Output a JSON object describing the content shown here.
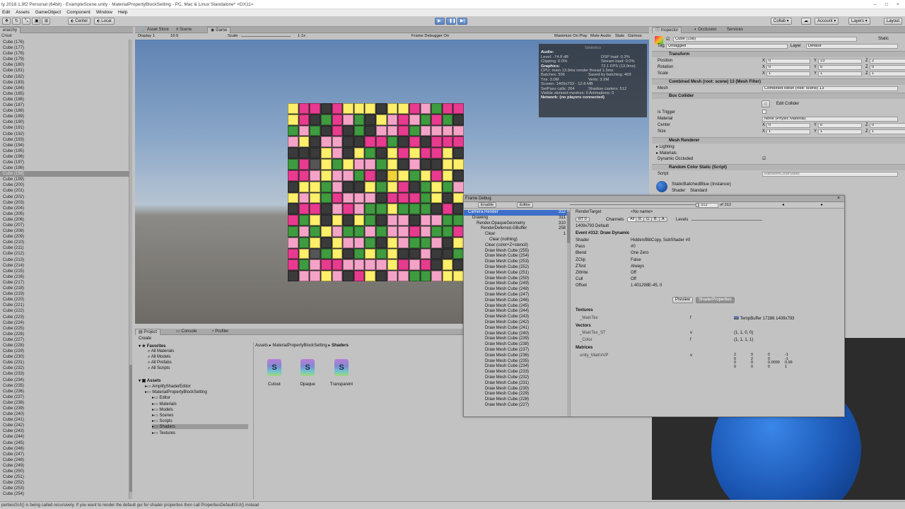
{
  "window": {
    "title": "ty 2018.1.9f2 Personal (64bit) - ExampleScene.unity - MaterialPropertyBlockSetting - PC, Mac & Linux Standalone* <DX11>"
  },
  "menu": [
    "Edit",
    "Assets",
    "GameObject",
    "Component",
    "Window",
    "Help"
  ],
  "toolbar": {
    "pivot": "Center",
    "space": "Local",
    "collab": "Collab",
    "account": "Account",
    "layers": "Layers",
    "layout": "Layout"
  },
  "hierarchy": {
    "tab": "erarchy",
    "create": "Creat",
    "selected_index": 23,
    "items": [
      "Cube (176)",
      "Cube (177)",
      "Cube (178)",
      "Cube (179)",
      "Cube (180)",
      "Cube (181)",
      "Cube (182)",
      "Cube (183)",
      "Cube (184)",
      "Cube (185)",
      "Cube (186)",
      "Cube (187)",
      "Cube (188)",
      "Cube (189)",
      "Cube (190)",
      "Cube (191)",
      "Cube (192)",
      "Cube (193)",
      "Cube (194)",
      "Cube (195)",
      "Cube (196)",
      "Cube (197)",
      "Cube (198)",
      "Cube (198)",
      "Cube (199)",
      "Cube (200)",
      "Cube (201)",
      "Cube (202)",
      "Cube (203)",
      "Cube (204)",
      "Cube (205)",
      "Cube (206)",
      "Cube (207)",
      "Cube (208)",
      "Cube (209)",
      "Cube (210)",
      "Cube (211)",
      "Cube (212)",
      "Cube (213)",
      "Cube (214)",
      "Cube (215)",
      "Cube (216)",
      "Cube (217)",
      "Cube (218)",
      "Cube (219)",
      "Cube (220)",
      "Cube (221)",
      "Cube (222)",
      "Cube (223)",
      "Cube (224)",
      "Cube (225)",
      "Cube (226)",
      "Cube (227)",
      "Cube (228)",
      "Cube (229)",
      "Cube (230)",
      "Cube (231)",
      "Cube (232)",
      "Cube (233)",
      "Cube (234)",
      "Cube (235)",
      "Cube (236)",
      "Cube (237)",
      "Cube (238)",
      "Cube (239)",
      "Cube (240)",
      "Cube (241)",
      "Cube (242)",
      "Cube (243)",
      "Cube (244)",
      "Cube (245)",
      "Cube (246)",
      "Cube (247)",
      "Cube (248)",
      "Cube (249)",
      "Cube (250)",
      "Cube (251)",
      "Cube (252)",
      "Cube (253)",
      "Cube (254)"
    ]
  },
  "center_tabs": {
    "asset_store": "Asset Store",
    "scene": "Scene",
    "game": "Game"
  },
  "game_bar": {
    "display": "Display 1",
    "aspect": "16:9",
    "scale_label": "Scale",
    "scale_value": "1.1x",
    "frame_debugger": "Frame Debugger On",
    "maximize": "Maximize On Play",
    "mute": "Mute Audio",
    "stats": "Stats",
    "gizmos": "Gizmos"
  },
  "cube_colors": [
    "#e83b8f",
    "#f2d33a",
    "#3bd1e8",
    "#7a4bd6",
    "#3f9b3f",
    "#f09a2d",
    "#2d6fd6",
    "#d9d9d9",
    "#f4a3c7",
    "#8fd14f",
    "#e84a4a",
    "#4ac7a0",
    "#3a3a3a",
    "#555555",
    "#6ac2ff",
    "#c04ad6",
    "#ffef6a",
    "#a07040",
    "#2e2e2e",
    "#47b8f0"
  ],
  "stats": {
    "title": "Statistics",
    "audio_label": "Audio:",
    "level": "Level: -74.8 dB",
    "dsp": "DSP load: 0.2%",
    "clipping": "Clipping: 0.0%",
    "stream": "Stream load: 0.0%",
    "graphics_label": "Graphics:",
    "fps": "72.1 FPS (13.9ms)",
    "cpu": "CPU: main 13.9ms  render thread 1.5ms",
    "batches": "Batches: 306",
    "saved": "Saved by batching: 469",
    "tris": "Tris: 3.0M",
    "verts": "Verts: 3.9M",
    "screen": "Screen: 1409x793 - 12.8 MB",
    "setpass": "SetPass calls: 264",
    "shadow": "Shadow casters: 512",
    "visible": "Visible skinned meshes: 0  Animations: 0",
    "network": "Network: (no players connected)"
  },
  "inspector": {
    "tabs": [
      "Inspector",
      "Occlusion",
      "Services"
    ],
    "name": "Cube (198)",
    "tag_label": "Tag",
    "tag": "Untagged",
    "layer_label": "Layer",
    "layer": "Default",
    "static": "Static",
    "transform": "Transform",
    "position": "Position",
    "rotation": "Rotation",
    "scale": "Scale",
    "pos": [
      "0",
      "13",
      "2"
    ],
    "rot": [
      "0",
      "0",
      "0"
    ],
    "scl": [
      "1",
      "1",
      "1"
    ],
    "mesh_filter": "Combined Mesh (root: scene) 13 (Mesh Filter)",
    "mesh_label": "Mesh",
    "mesh_value": "Combined Mesh (root: scene) 13",
    "box_collider": "Box Collider",
    "edit_collider": "Edit Collider",
    "is_trigger": "Is Trigger",
    "material_label": "Material",
    "material_value": "None (Physic Material)",
    "center_label": "Center",
    "size_label": "Size",
    "center": [
      "0",
      "0",
      "0"
    ],
    "size": [
      "1",
      "1",
      "1"
    ],
    "mesh_renderer": "Mesh Renderer",
    "lighting": "Lighting",
    "materials": "Materials",
    "dynamic_occluded": "Dynamic Occluded",
    "random_color": "Random Color Static (Script)",
    "script_label": "Script",
    "script_value": "RandomColorStatic",
    "material_instance": "StaticBatchedBlue (Instance)",
    "shader_label": "Shader",
    "shader_value": "Standard"
  },
  "project": {
    "tabs": [
      "Project",
      "Console",
      "Profiler"
    ],
    "create": "Create",
    "favorites": "Favorites",
    "fav_items": [
      "All Materials",
      "All Models",
      "All Prefabs",
      "All Scripts"
    ],
    "assets": "Assets",
    "asset_items": [
      "AmplifyShaderEditor",
      "MaterialPropertyBlockSetting",
      "Editor",
      "Materials",
      "Models",
      "Scenes",
      "Scripts",
      "Shaders",
      "Textures"
    ],
    "breadcrumb": [
      "Assets",
      "MaterialPropertyBlockSetting",
      "Shaders"
    ],
    "files": [
      "Cutout",
      "Opaque",
      "Transparent"
    ]
  },
  "frame_debug": {
    "title": "Frame Debug",
    "enable": "Enable",
    "editor": "Editor",
    "event_index": "312",
    "event_total": "of 312",
    "rows": [
      {
        "t": "Camera.Render",
        "n": "312",
        "d": 0
      },
      {
        "t": "Drawing",
        "n": "311",
        "d": 1
      },
      {
        "t": "Render.OpaqueGeometry",
        "n": "310",
        "d": 2
      },
      {
        "t": "RenderDeferred.GBuffer",
        "n": "258",
        "d": 3
      },
      {
        "t": "Clear",
        "n": "1",
        "d": 4
      },
      {
        "t": "Clear (nothing)",
        "n": "",
        "d": 5
      },
      {
        "t": "Clear (color+Z+stencil)",
        "n": "",
        "d": 4
      },
      {
        "t": "Draw Mesh Cube (255)",
        "n": "",
        "d": 4
      },
      {
        "t": "Draw Mesh Cube (254)",
        "n": "",
        "d": 4
      },
      {
        "t": "Draw Mesh Cube (253)",
        "n": "",
        "d": 4
      },
      {
        "t": "Draw Mesh Cube (252)",
        "n": "",
        "d": 4
      },
      {
        "t": "Draw Mesh Cube (251)",
        "n": "",
        "d": 4
      },
      {
        "t": "Draw Mesh Cube (250)",
        "n": "",
        "d": 4
      },
      {
        "t": "Draw Mesh Cube (249)",
        "n": "",
        "d": 4
      },
      {
        "t": "Draw Mesh Cube (248)",
        "n": "",
        "d": 4
      },
      {
        "t": "Draw Mesh Cube (247)",
        "n": "",
        "d": 4
      },
      {
        "t": "Draw Mesh Cube (246)",
        "n": "",
        "d": 4
      },
      {
        "t": "Draw Mesh Cube (245)",
        "n": "",
        "d": 4
      },
      {
        "t": "Draw Mesh Cube (244)",
        "n": "",
        "d": 4
      },
      {
        "t": "Draw Mesh Cube (243)",
        "n": "",
        "d": 4
      },
      {
        "t": "Draw Mesh Cube (242)",
        "n": "",
        "d": 4
      },
      {
        "t": "Draw Mesh Cube (241)",
        "n": "",
        "d": 4
      },
      {
        "t": "Draw Mesh Cube (240)",
        "n": "",
        "d": 4
      },
      {
        "t": "Draw Mesh Cube (239)",
        "n": "",
        "d": 4
      },
      {
        "t": "Draw Mesh Cube (238)",
        "n": "",
        "d": 4
      },
      {
        "t": "Draw Mesh Cube (237)",
        "n": "",
        "d": 4
      },
      {
        "t": "Draw Mesh Cube (236)",
        "n": "",
        "d": 4
      },
      {
        "t": "Draw Mesh Cube (235)",
        "n": "",
        "d": 4
      },
      {
        "t": "Draw Mesh Cube (234)",
        "n": "",
        "d": 4
      },
      {
        "t": "Draw Mesh Cube (233)",
        "n": "",
        "d": 4
      },
      {
        "t": "Draw Mesh Cube (232)",
        "n": "",
        "d": 4
      },
      {
        "t": "Draw Mesh Cube (231)",
        "n": "",
        "d": 4
      },
      {
        "t": "Draw Mesh Cube (230)",
        "n": "",
        "d": 4
      },
      {
        "t": "Draw Mesh Cube (229)",
        "n": "",
        "d": 4
      },
      {
        "t": "Draw Mesh Cube (228)",
        "n": "",
        "d": 4
      },
      {
        "t": "Draw Mesh Cube (227)",
        "n": "",
        "d": 4
      }
    ],
    "render_target_label": "RenderTarget",
    "render_target": "<No name>",
    "rt": "RT 0",
    "channels": "Channels",
    "ch": [
      "All",
      "R",
      "G",
      "B",
      "A"
    ],
    "levels": "Levels",
    "res": "1409x793 Default",
    "event": "Event #312: Draw Dynamic",
    "props": [
      [
        "Shader",
        "Hidden/BlitCopy, SubShader #0"
      ],
      [
        "Pass",
        "#0"
      ],
      [
        "Blend",
        "One Zero"
      ],
      [
        "ZClip",
        "False"
      ],
      [
        "ZTest",
        "Always"
      ],
      [
        "ZWrite",
        "Off"
      ],
      [
        "Cull",
        "Off"
      ],
      [
        "Offset",
        "1.401298E-45, 0"
      ]
    ],
    "preview": "Preview",
    "shader_properties": "ShaderProperties",
    "textures": "Textures",
    "tex_name": "_MainTex",
    "tex_f": "f",
    "tex_value": "TempBuffer 17286 1409x793",
    "vectors": "Vectors",
    "vec": [
      [
        "_MainTex_ST",
        "v",
        "(1, 1, 0, 0)"
      ],
      [
        "_Color",
        "f",
        "(1, 1, 1, 1)"
      ]
    ],
    "matrices": "Matrices",
    "mat_name": "unity_MatrixVP",
    "mat_v": "v",
    "matrix": [
      [
        "2",
        "0",
        "0",
        "-1"
      ],
      [
        "0",
        "2",
        "0",
        "-1"
      ],
      [
        "0",
        "0",
        "0.0099",
        "0.99"
      ],
      [
        "0",
        "0",
        "0",
        "1"
      ]
    ]
  },
  "status": "pertiesGUI() is being called recursively. If you want to render the default gui for shader properties then call PropertiesDefaultGUI() instead"
}
